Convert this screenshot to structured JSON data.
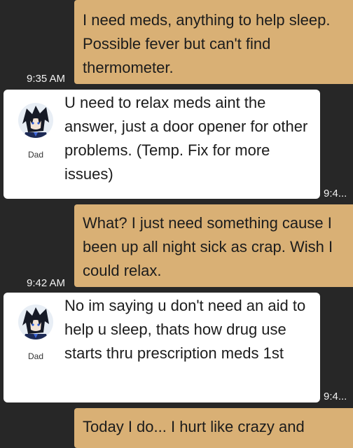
{
  "messages": [
    {
      "direction": "outgoing",
      "text": "I need meds, anything to help sleep. Possible fever but can't find thermometer.",
      "time": "9:35 AM"
    },
    {
      "direction": "incoming",
      "sender": "Dad",
      "text": "U need to relax meds aint the answer, just a door opener for other problems.  (Temp. Fix for more issues)",
      "time": "9:4..."
    },
    {
      "direction": "outgoing",
      "text": "What? I just need something cause I been up all night sick as crap. Wish I could relax.",
      "time": "9:42 AM"
    },
    {
      "direction": "incoming",
      "sender": "Dad",
      "text": "No im saying u don't need an aid to help u sleep, thats how drug use starts thru prescription meds 1st",
      "time": "9:4..."
    },
    {
      "direction": "outgoing",
      "text": "Today I do... I hurt like crazy and",
      "time": ""
    }
  ],
  "colors": {
    "background": "#272727",
    "outgoing_bubble": "#d9b075",
    "incoming_bubble": "#ffffff",
    "time_text": "#f2f2f2"
  },
  "icons": {
    "avatar": "anime-character-avatar"
  }
}
